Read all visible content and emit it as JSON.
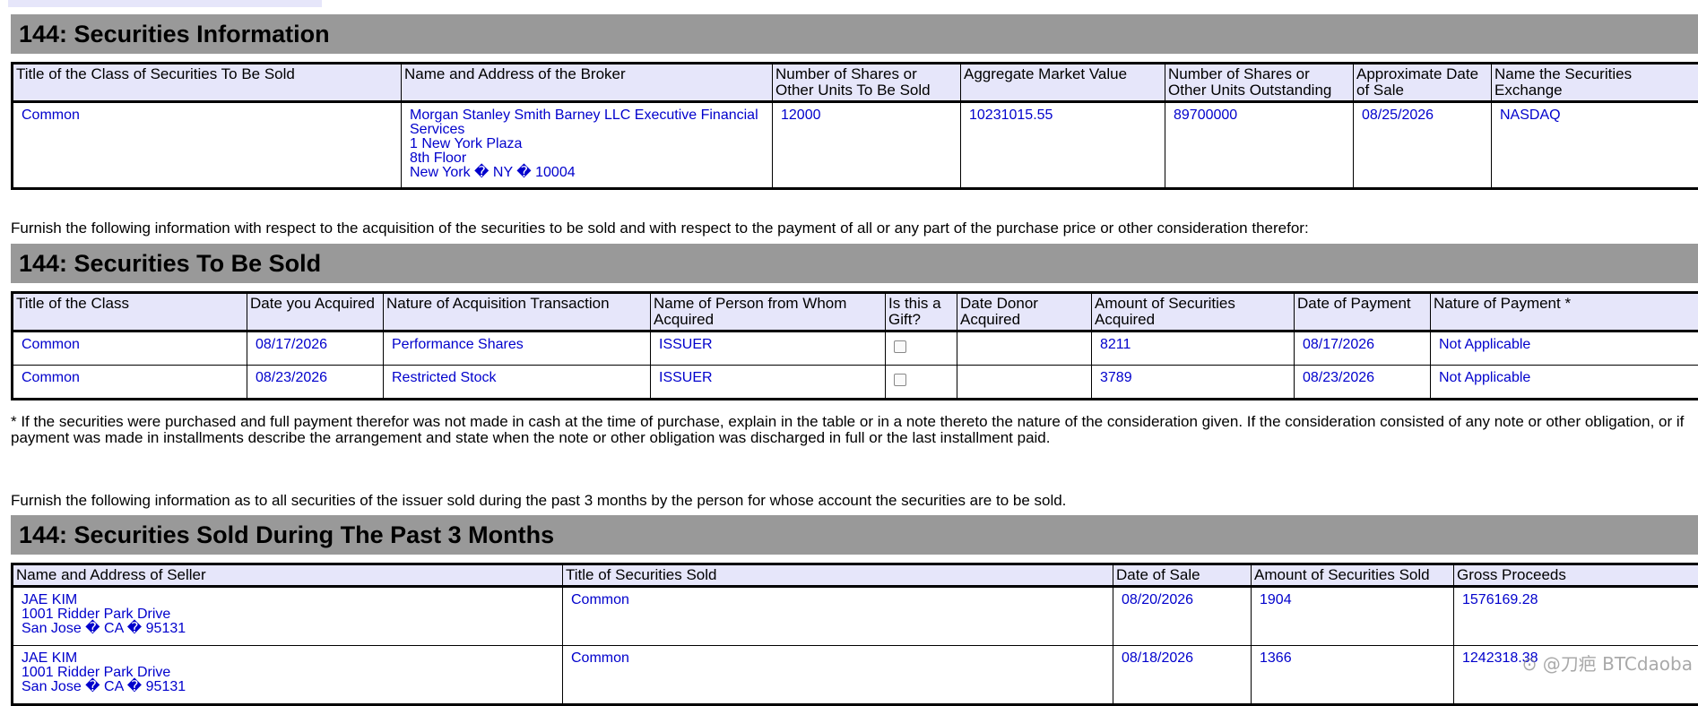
{
  "sections": {
    "securities_info_title": "144: Securities Information",
    "to_be_sold_title": "144: Securities To Be Sold",
    "past3_title": "144: Securities Sold During The Past 3 Months"
  },
  "securities_info": {
    "headers": [
      "Title of the Class of Securities To Be Sold",
      "Name and Address of the Broker",
      "Number of Shares or Other Units To Be Sold",
      "Aggregate Market Value",
      "Number of Shares or Other Units Outstanding",
      "Approximate Date of Sale",
      "Name the Securities Exchange"
    ],
    "row": {
      "title_class": "Common",
      "broker_name": "Morgan Stanley Smith Barney LLC Executive Financial Services",
      "broker_addr1": "1 New York Plaza",
      "broker_addr2": "8th Floor",
      "broker_addr3": "New York � NY � 10004",
      "shares_to_sell": "12000",
      "market_value": "10231015.55",
      "shares_outstanding": "89700000",
      "approx_date": "08/25/2026",
      "exchange": "NASDAQ"
    }
  },
  "para_acquisition": "Furnish the following information with respect to the acquisition of the securities to be sold and with respect to the payment of all or any part of the purchase price or other consideration therefor:",
  "to_be_sold": {
    "headers": [
      "Title of the Class",
      "Date you Acquired",
      "Nature of Acquisition Transaction",
      "Name of Person from Whom Acquired",
      "Is this a Gift?",
      "Date Donor Acquired",
      "Amount of Securities Acquired",
      "Date of Payment",
      "Nature of Payment *"
    ],
    "rows": [
      {
        "title": "Common",
        "date_acquired": "08/17/2026",
        "nature": "Performance Shares",
        "from": "ISSUER",
        "gift": false,
        "donor_date": "",
        "amount": "8211",
        "payment_date": "08/17/2026",
        "payment_nature": "Not Applicable"
      },
      {
        "title": "Common",
        "date_acquired": "08/23/2026",
        "nature": "Restricted Stock",
        "from": "ISSUER",
        "gift": false,
        "donor_date": "",
        "amount": "3789",
        "payment_date": "08/23/2026",
        "payment_nature": "Not Applicable"
      }
    ]
  },
  "para_footnote": "* If the securities were purchased and full payment therefor was not made in cash at the time of purchase, explain in the table or in a note thereto the nature of the consideration given. If the consideration consisted of any note or other obligation, or if payment was made in installments describe the arrangement and state when the note or other obligation was discharged in full or the last installment paid.",
  "para_past3": "Furnish the following information as to all securities of the issuer sold during the past 3 months by the person for whose account the securities are to be sold.",
  "past3": {
    "headers": [
      "Name and Address of Seller",
      "Title of Securities Sold",
      "Date of Sale",
      "Amount of Securities Sold",
      "Gross Proceeds"
    ],
    "rows": [
      {
        "name": "JAE KIM",
        "addr1": "1001 Ridder Park Drive",
        "addr2": "San Jose � CA � 95131",
        "title": "Common",
        "date": "08/20/2026",
        "amount": "1904",
        "proceeds": "1576169.28"
      },
      {
        "name": "JAE KIM",
        "addr1": "1001 Ridder Park Drive",
        "addr2": "San Jose � CA � 95131",
        "title": "Common",
        "date": "08/18/2026",
        "amount": "1366",
        "proceeds": "1242318.38"
      }
    ]
  },
  "watermark": "⊙ @刀疤 BTCdaoba",
  "colors": {
    "header_bg": "#999999",
    "th_bg": "#e6e6fa",
    "value_text": "#0000cc",
    "tab": "#e6e6fa"
  }
}
